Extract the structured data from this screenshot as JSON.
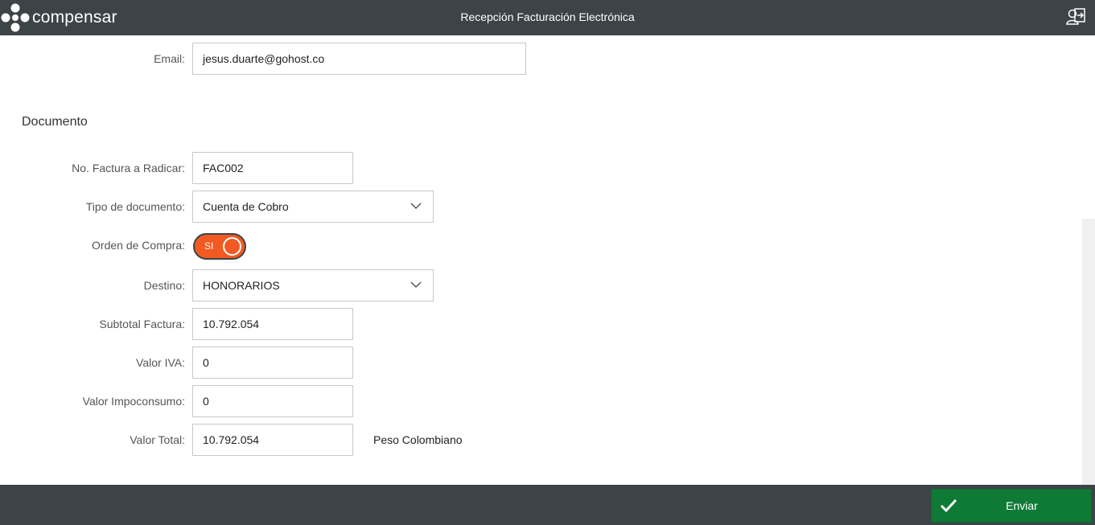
{
  "header": {
    "brand": "compensar",
    "title": "Recepción Facturación Electrónica",
    "exit_icon": "user-exit-icon"
  },
  "contact": {
    "email_label": "Email:",
    "email_value": "jesus.duarte@gohost.co"
  },
  "document": {
    "section_title": "Documento",
    "invoice_number_label": "No. Factura a Radicar:",
    "invoice_number_value": "FAC002",
    "doc_type_label": "Tipo de documento:",
    "doc_type_value": "Cuenta de Cobro",
    "purchase_order_label": "Orden de Compra:",
    "purchase_order_toggle": "SI",
    "destination_label": "Destino:",
    "destination_value": "HONORARIOS",
    "subtotal_label": "Subtotal Factura:",
    "subtotal_value": "10.792.054",
    "iva_label": "Valor IVA:",
    "iva_value": "0",
    "impoconsumo_label": "Valor Impoconsumo:",
    "impoconsumo_value": "0",
    "total_label": "Valor Total:",
    "total_value": "10.792.054",
    "currency": "Peso Colombiano"
  },
  "footer": {
    "send_label": "Enviar",
    "send_icon": "checkmark-icon"
  },
  "colors": {
    "topbar": "#3d4447",
    "accent_orange": "#f15a22",
    "send_green": "#0f7a35"
  }
}
